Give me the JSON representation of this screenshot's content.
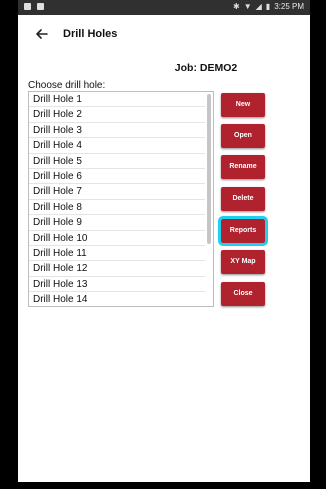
{
  "status_bar": {
    "left_icons": [
      "image-icon",
      "notification-icon"
    ],
    "right_glyphs": [
      "bluetooth-icon",
      "wifi-icon",
      "signal-icon",
      "battery-icon"
    ],
    "time": "3:25 PM"
  },
  "app_bar": {
    "title": "Drill Holes"
  },
  "job": {
    "label": "Job: DEMO2"
  },
  "list": {
    "caption": "Choose drill hole:",
    "items": [
      "Drill Hole 1",
      "Drill Hole 2",
      "Drill Hole 3",
      "Drill Hole 4",
      "Drill Hole 5",
      "Drill Hole 6",
      "Drill Hole 7",
      "Drill Hole 8",
      "Drill Hole 9",
      "Drill Hole 10",
      "Drill Hole 11",
      "Drill Hole 12",
      "Drill Hole 13",
      "Drill Hole 14"
    ]
  },
  "buttons": {
    "new": "New",
    "open": "Open",
    "rename": "Rename",
    "delete": "Delete",
    "reports": "Reports",
    "xy_map": "XY Map",
    "close": "Close"
  },
  "colors": {
    "button": "#b0222e",
    "focus_ring": "#1fd0f0",
    "status_bar": "#303030"
  }
}
